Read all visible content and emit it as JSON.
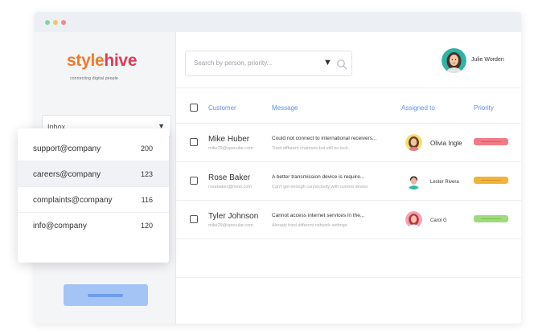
{
  "brand": {
    "logo_style": "style",
    "logo_hive": "hive",
    "tagline": "connecting digital people",
    "colors": {
      "style": "#f07a2b",
      "hive": "#e23b55"
    }
  },
  "window": {
    "dots": [
      "#7ed6a8",
      "#f6c36b",
      "#f08a8a"
    ]
  },
  "sidebar": {
    "inbox_label": "Inbox",
    "inbox_caret": "▼"
  },
  "search": {
    "placeholder": "Search by person, priority...",
    "caret": "▼",
    "icon": "search-icon"
  },
  "user": {
    "name": "Julie Worden"
  },
  "table": {
    "headers": {
      "customer": "Customer",
      "message": "Message",
      "assigned": "Assigned to",
      "priority": "Priority"
    },
    "rows": [
      {
        "name": "Mike Huber",
        "email": "mike29@specular.com",
        "message": "Could not connect to international receivers...",
        "message_sub": "Tried different channels but still no luck.",
        "assignee": "Olivia Ingle",
        "priority_color": "#f07b86",
        "priority_line": "#d65a66"
      },
      {
        "name": "Rose Baker",
        "email": "rosebaker@mext.com",
        "message": "A better transmission device is require...",
        "message_sub": "Can't get enough connectivity with current device",
        "assignee": "Lester Rivera",
        "priority_color": "#f0b43c",
        "priority_line": "#d49420"
      },
      {
        "name": "Tyler Johnson",
        "email": "mike29@specular.com",
        "message": "Cannot access internet services in the...",
        "message_sub": "Already tried different network settings.",
        "assignee": "Carol G",
        "priority_color": "#9edb7c",
        "priority_line": "#79c055"
      }
    ]
  },
  "dropdown": {
    "items": [
      {
        "label": "support@company",
        "count": "200"
      },
      {
        "label": "careers@company",
        "count": "123"
      },
      {
        "label": "complaints@company",
        "count": "116"
      },
      {
        "label": "info@company",
        "count": "120"
      }
    ]
  }
}
